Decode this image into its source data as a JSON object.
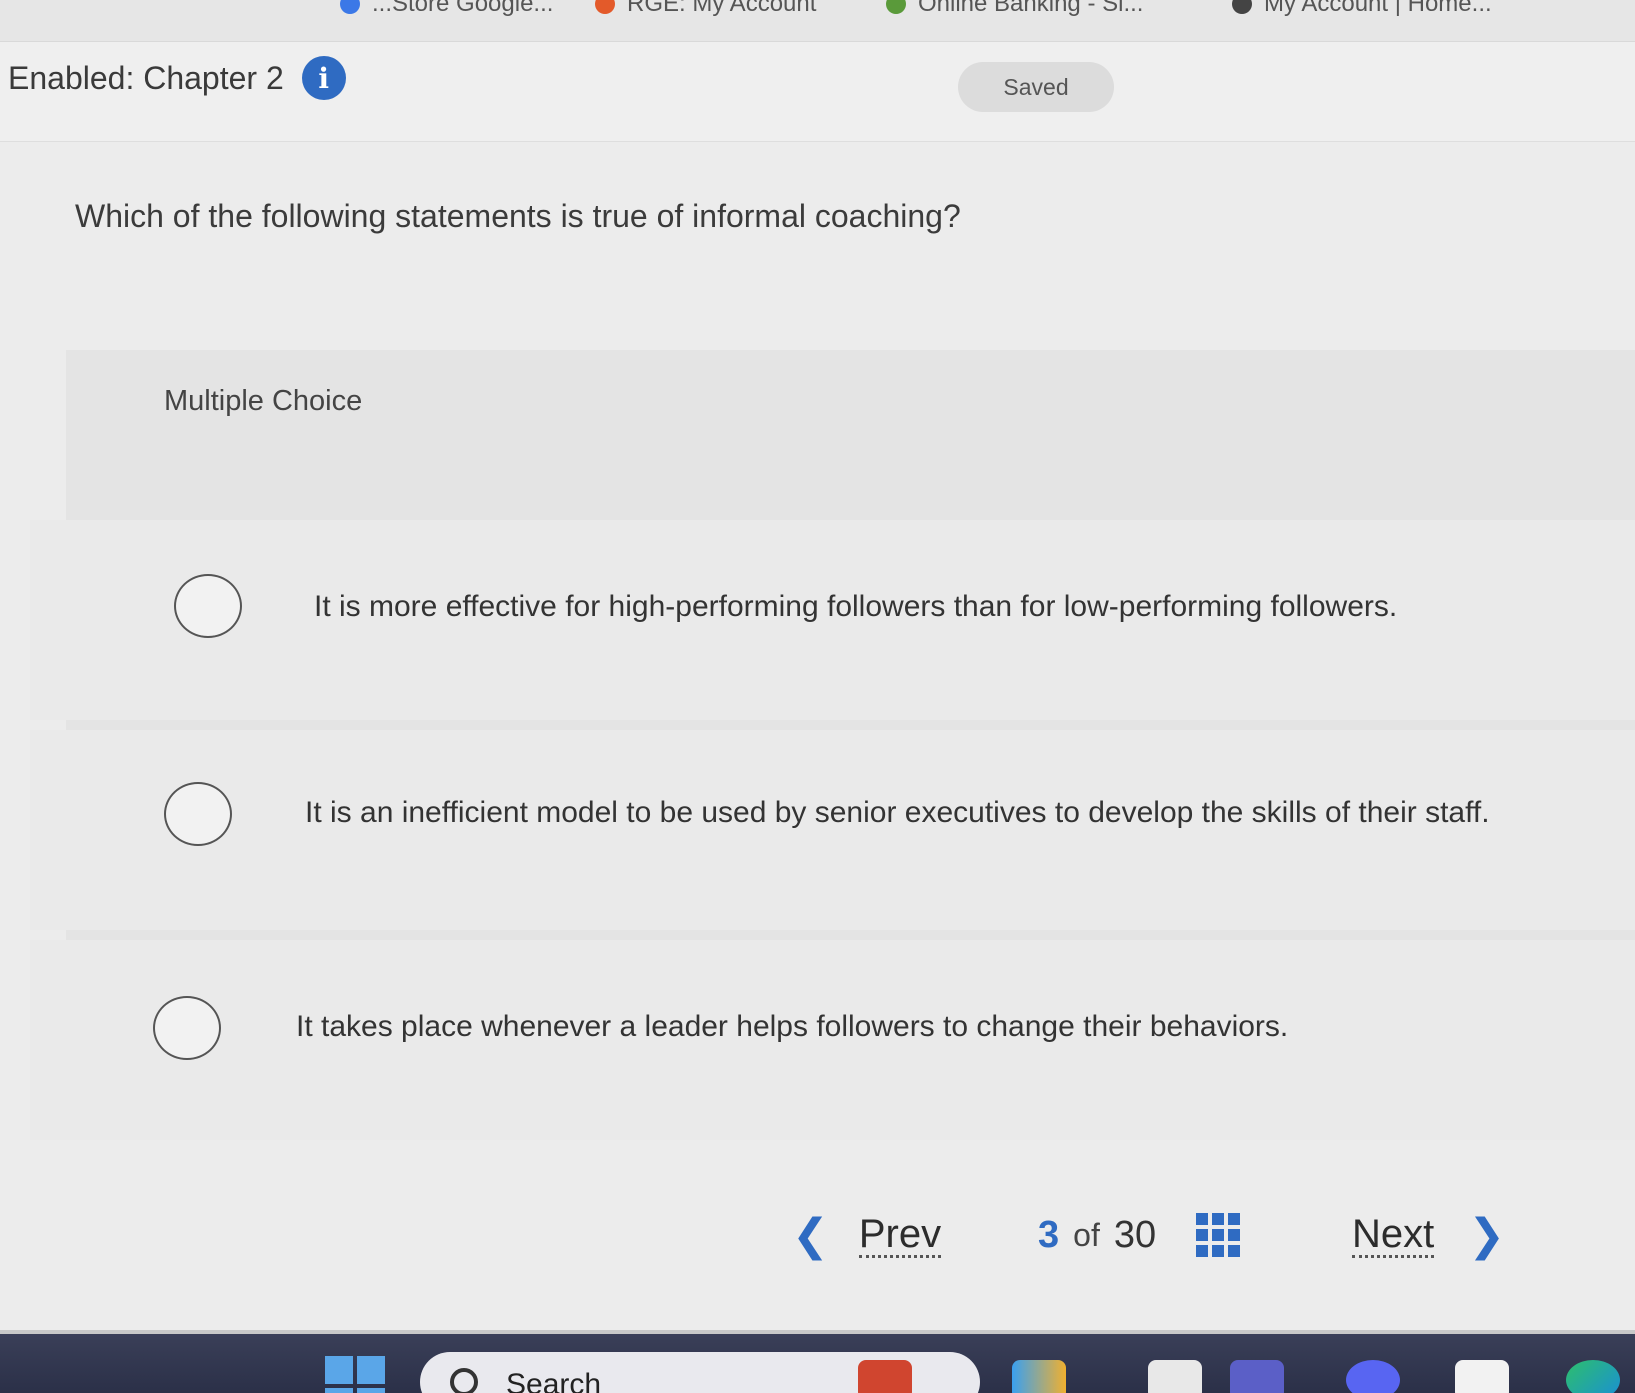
{
  "bookmarks": [
    {
      "label": "...Store Google...",
      "color": "#3b78e7"
    },
    {
      "label": "RGE: My Account",
      "color": "#e35a2a"
    },
    {
      "label": "Online Banking - Si...",
      "color": "#5a9a3a"
    },
    {
      "label": "My Account | Home...",
      "color": "#444444"
    }
  ],
  "header": {
    "title": "Enabled: Chapter 2",
    "info_glyph": "i",
    "status": "Saved"
  },
  "question": {
    "prompt": "Which of the following statements is true of informal coaching?",
    "type_label": "Multiple Choice",
    "options": [
      {
        "text": "It is more effective for high-performing followers than for low-performing followers.",
        "selected": false
      },
      {
        "text": "It is an inefficient model to be used by senior executives to develop the skills of their staff.",
        "selected": false
      },
      {
        "text": "It takes place whenever a leader helps followers to change their behaviors.",
        "selected": false
      }
    ]
  },
  "navigation": {
    "prev_label": "Prev",
    "prev_icon": "chevron-left-icon",
    "current_page": "3",
    "of_label": "of",
    "total_pages": "30",
    "grid_icon": "question-grid-icon",
    "next_label": "Next",
    "next_icon": "chevron-right-icon"
  },
  "taskbar": {
    "search_label": "Search",
    "apps": [
      "start",
      "search",
      "gaming-app",
      "copilot",
      "files",
      "teams",
      "discord",
      "store",
      "edge"
    ]
  },
  "colors": {
    "accent": "#2f6bc2",
    "background": "#ececec",
    "panel": "#e4e4e4",
    "taskbar": "#2f344c"
  }
}
